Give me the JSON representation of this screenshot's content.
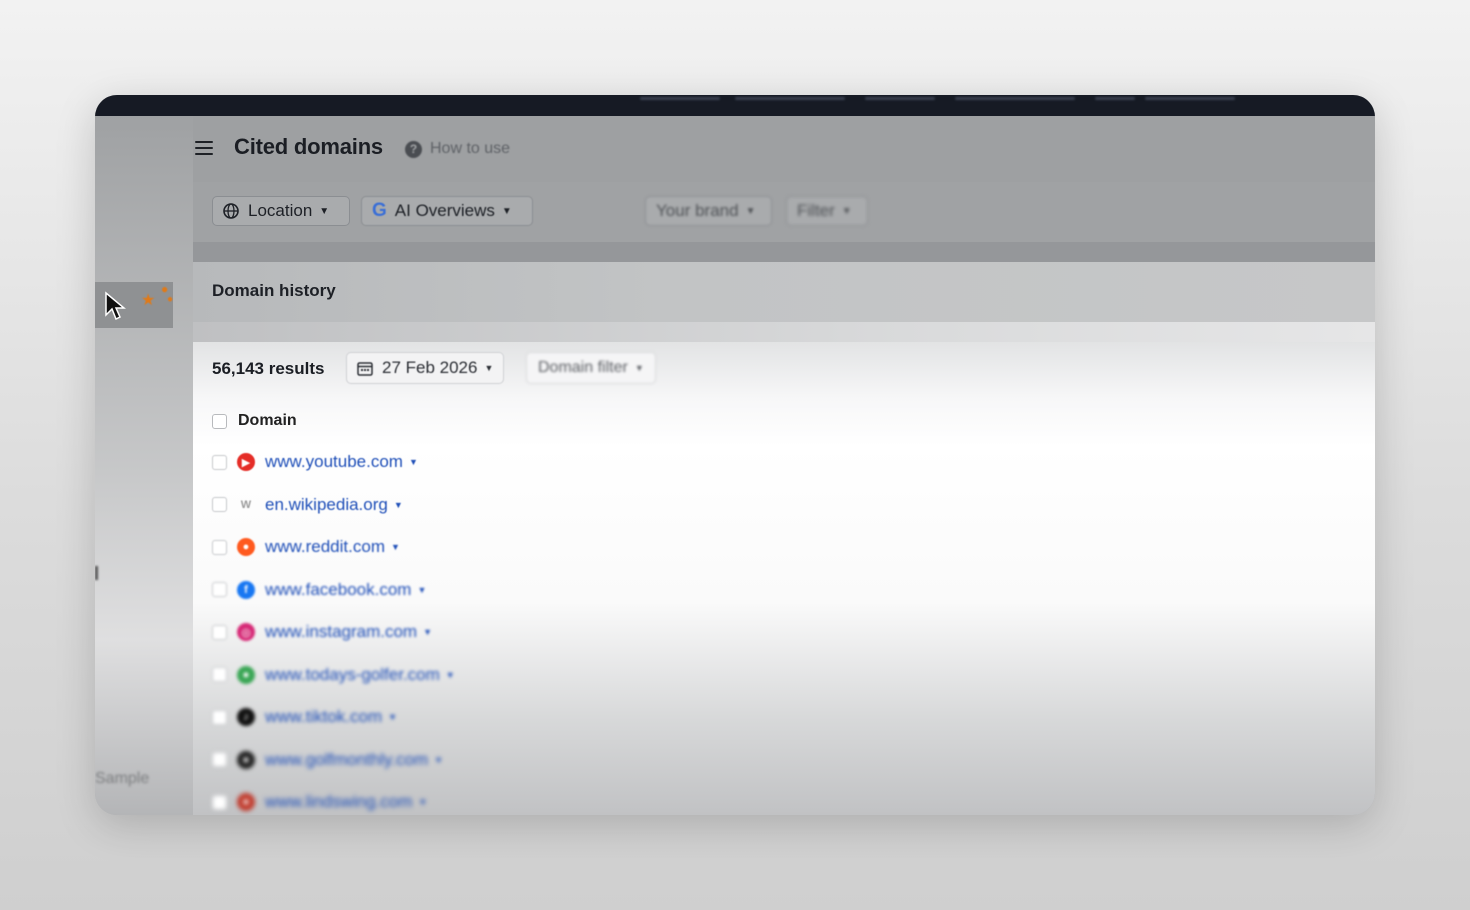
{
  "header": {
    "title": "Cited domains",
    "help_label": "How to use"
  },
  "filters": {
    "location_label": "Location",
    "ai_label": "AI Overviews",
    "brand_label": "Your brand",
    "filter_label": "Filter"
  },
  "section": {
    "title": "Domain history"
  },
  "results_bar": {
    "count": "56,143 results",
    "date": "27 Feb 2026",
    "domain_filter": "Domain filter"
  },
  "table": {
    "column_header": "Domain",
    "rows": [
      {
        "domain": "www.youtube.com",
        "icon": "youtube-icon",
        "color": "#e52d27"
      },
      {
        "domain": "en.wikipedia.org",
        "icon": "wikipedia-icon",
        "color": "#9a9a9a"
      },
      {
        "domain": "www.reddit.com",
        "icon": "reddit-icon",
        "color": "#ff5a1f"
      },
      {
        "domain": "www.facebook.com",
        "icon": "facebook-icon",
        "color": "#1877f2"
      },
      {
        "domain": "www.instagram.com",
        "icon": "instagram-icon",
        "color": "#d62976"
      },
      {
        "domain": "www.todays-golfer.com",
        "icon": "todays-golfer-icon",
        "color": "#3aa655"
      },
      {
        "domain": "www.tiktok.com",
        "icon": "tiktok-icon",
        "color": "#111111"
      },
      {
        "domain": "www.golfmonthly.com",
        "icon": "golfmonthly-icon",
        "color": "#222222"
      },
      {
        "domain": "www.lindswing.com",
        "icon": "lindswing-icon",
        "color": "#c0392b"
      }
    ]
  },
  "sidebar": {
    "sample_label": "Sample"
  }
}
